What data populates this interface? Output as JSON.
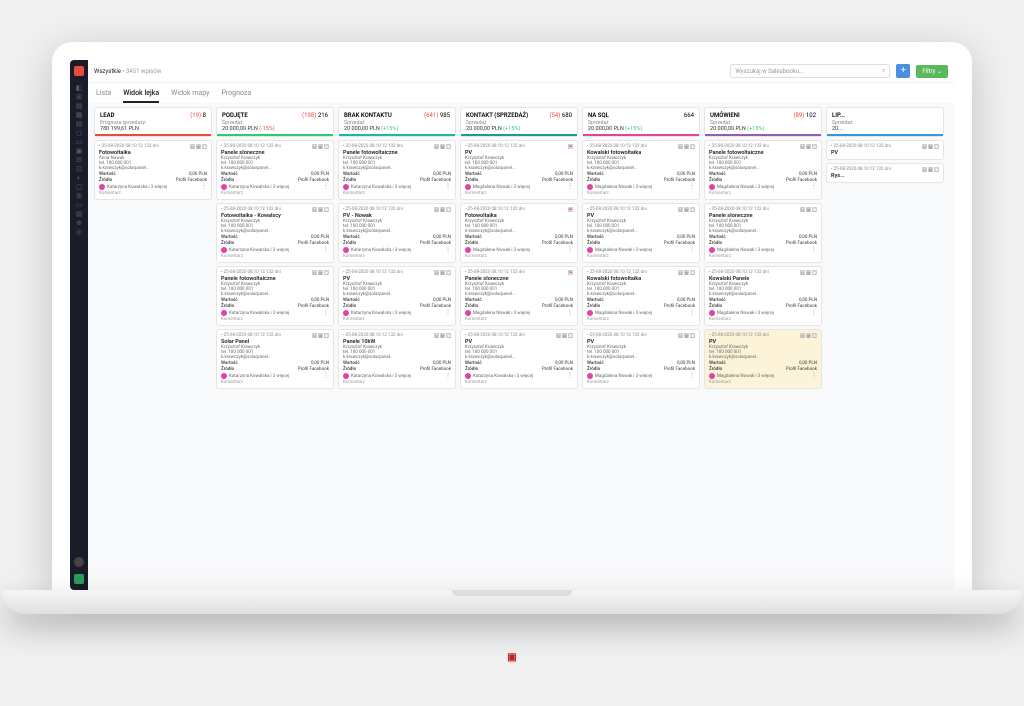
{
  "breadcrumb": {
    "main": "Wszystkie",
    "sub": "• 3451 wpisów"
  },
  "search": {
    "placeholder": "Wyszukaj w Salesbooku..."
  },
  "buttons": {
    "add": "+",
    "filter": "Filtry ⌄"
  },
  "tabs": [
    "Lista",
    "Widok lejka",
    "Widok mapy",
    "Prognoza"
  ],
  "active_tab": 1,
  "sidebar_icons": [
    "◧",
    "⊞",
    "▤",
    "▦",
    "▤",
    "◻",
    "▭",
    "▣",
    "⊟",
    "⊡",
    "◐",
    "▢",
    "⊞",
    "▭",
    "▤",
    "⊕",
    "◎"
  ],
  "common": {
    "wartosc_label": "Wartość",
    "zrodlo_label": "Źródło",
    "wartosc_value": "0,00 PLN",
    "zrodlo_value": "Profil Facebook",
    "komentarz_label": "Komentarz",
    "date": "• 25-08-2020  08:10:12  132 dni",
    "person": "Krzysztof Krawczyk",
    "tel": "tel. 100 000 001",
    "email": "k.krawczyk@solarpanel...",
    "people_kk": "Katarzyna Kowalska i 3 więcej",
    "people_mn": "Magdalena Nowak i 3 więcej"
  },
  "columns": [
    {
      "color": "red",
      "name": "LEAD",
      "count_pre": "(19)",
      "count": "8",
      "sub": "Prognoza sprzedaży:",
      "value": "780 199,61 PLN",
      "delta": "",
      "cards": [
        {
          "title": "Fotowoltaika",
          "person": "Anna Nowak",
          "people": "kk",
          "icons": [
            "▤",
            "▢"
          ]
        }
      ]
    },
    {
      "color": "green",
      "name": "PODJĘTE",
      "count_pre": "(198)",
      "count": "216",
      "sub": "Sprzedaż",
      "value": "20 000,00 PLN",
      "delta": "(-15%)",
      "cards": [
        {
          "title": "Panele słoneczne",
          "people": "kk"
        },
        {
          "title": "Fotowoltaika - Kowalscy",
          "people": "kk"
        },
        {
          "title": "Panele fotowoltaiczne",
          "people": "kk"
        },
        {
          "title": "Solar Panel",
          "people": "kk"
        }
      ]
    },
    {
      "color": "teal",
      "name": "BRAK KONTAKTU",
      "count_pre": "(641)",
      "count": "985",
      "sub": "Sprzedaż",
      "value": "20 000,00 PLN",
      "delta": "(+15%)",
      "cards": [
        {
          "title": "Panele fotowoltaiczne",
          "people": "kk"
        },
        {
          "title": "PV - Nowak",
          "people": "kk"
        },
        {
          "title": "PV",
          "people": "kk"
        },
        {
          "title": "Panele 10kW",
          "people": "kk"
        }
      ]
    },
    {
      "color": "teal2",
      "name": "KONTAKT (SPRZEDAŻ)",
      "count_pre": "(54)",
      "count": "680",
      "sub": "Sprzedaż",
      "value": "20 000,00 PLN",
      "delta": "(+15%)",
      "cards": [
        {
          "title": "PV",
          "people": "mn",
          "red_icon": true
        },
        {
          "title": "Fotowoltaika",
          "people": "mn",
          "red_icon": true
        },
        {
          "title": "Panele słoneczne",
          "people": "mn",
          "red_icon": true
        },
        {
          "title": "PV",
          "people": "kk"
        }
      ]
    },
    {
      "color": "pink",
      "name": "NA SQL",
      "count_pre": "",
      "count": "664",
      "sub": "Sprzedaż",
      "value": "20 000,00 PLN",
      "delta": "(+15%)",
      "cards": [
        {
          "title": "Kowalski fotowoltaika",
          "people": "mn"
        },
        {
          "title": "PV",
          "people": "mn"
        },
        {
          "title": "Kowalski fotowoltaika",
          "people": "mn"
        },
        {
          "title": "PV",
          "people": "mn"
        }
      ]
    },
    {
      "color": "purple",
      "name": "UMÓWIENI",
      "count_pre": "(89)",
      "count": "102",
      "sub": "Sprzedaż",
      "value": "20 000,00 PLN",
      "delta": "(+15%)",
      "cards": [
        {
          "title": "Panele fotowoltaiczne",
          "people": "mn"
        },
        {
          "title": "Panele słoneczne",
          "people": "mn"
        },
        {
          "title": "Kowalski Panele",
          "people": "mn"
        },
        {
          "title": "PV",
          "people": "mn",
          "highlighted": true
        }
      ]
    },
    {
      "color": "blue",
      "name": "LIP...",
      "count_pre": "",
      "count": "",
      "sub": "Sprzedaż",
      "value": "20...",
      "delta": "",
      "cards": [
        {
          "title": "PV",
          "partial": true
        },
        {
          "title": "Rys...",
          "partial": true
        }
      ]
    }
  ]
}
